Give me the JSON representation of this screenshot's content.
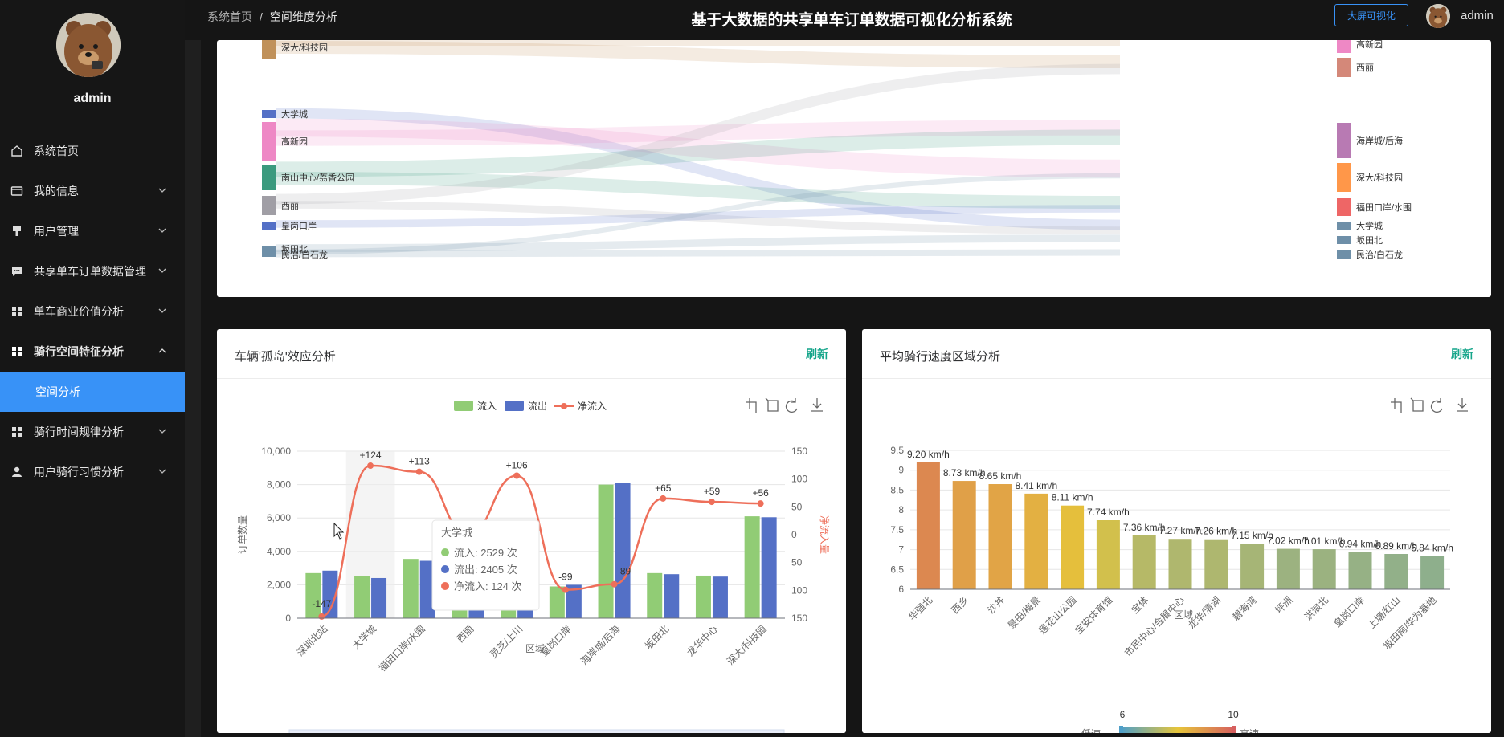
{
  "profile": {
    "name": "admin"
  },
  "menu": {
    "items": [
      {
        "label": "系统首页",
        "icon": "home-icon",
        "has_children": false
      },
      {
        "label": "我的信息",
        "icon": "id-card-icon",
        "has_children": true
      },
      {
        "label": "用户管理",
        "icon": "user-manage-icon",
        "has_children": true
      },
      {
        "label": "共享单车订单数据管理",
        "icon": "message-icon",
        "has_children": true
      },
      {
        "label": "单车商业价值分析",
        "icon": "grid-icon",
        "has_children": true
      },
      {
        "label": "骑行空间特征分析",
        "icon": "grid-icon",
        "has_children": true,
        "open": true
      },
      {
        "label": "骑行时间规律分析",
        "icon": "grid-icon",
        "has_children": true
      },
      {
        "label": "用户骑行习惯分析",
        "icon": "user-icon",
        "has_children": true
      }
    ],
    "active_sub": "空间分析"
  },
  "header": {
    "breadcrumb_home": "系统首页",
    "breadcrumb_sep": "/",
    "breadcrumb_current": "空间维度分析",
    "title": "基于大数据的共享单车订单数据可视化分析系统",
    "big_screen_label": "大屏可视化",
    "user": "admin"
  },
  "sankey": {
    "left_nodes": [
      {
        "label": "深大/科技园",
        "color": "#c0915a"
      },
      {
        "label": "大学城",
        "color": "#5470c6"
      },
      {
        "label": "高新园",
        "color": "#ee88c5"
      },
      {
        "label": "南山中心/荔香公园",
        "color": "#3b9a7e"
      },
      {
        "label": "西丽",
        "color": "#a09ea5"
      },
      {
        "label": "皇岗口岸",
        "color": "#5470c6"
      },
      {
        "label": "坂田北",
        "color": "#6e8fa8"
      },
      {
        "label": "民治/白石龙",
        "color": "#6e8fa8"
      }
    ],
    "right_nodes": [
      {
        "label": "高新园",
        "color": "#ee88c5"
      },
      {
        "label": "西丽",
        "color": "#d48879"
      },
      {
        "label": "海岸城/后海",
        "color": "#b87ab3"
      },
      {
        "label": "深大/科技园",
        "color": "#ff9749"
      },
      {
        "label": "福田口岸/水围",
        "color": "#ee6666"
      },
      {
        "label": "大学城",
        "color": "#6e8fa8"
      },
      {
        "label": "坂田北",
        "color": "#6e8fa8"
      },
      {
        "label": "民治/白石龙",
        "color": "#6e8fa8"
      }
    ]
  },
  "island_card": {
    "title": "车辆'孤岛'效应分析",
    "refresh": "刷新",
    "legend": [
      "流入",
      "流出",
      "净流入"
    ],
    "tooltip": {
      "title": "大学城",
      "lines": [
        "流入: 2529 次",
        "流出: 2405 次",
        "净流入: 124 次"
      ]
    }
  },
  "speed_card": {
    "title": "平均骑行速度区域分析",
    "refresh": "刷新",
    "visual_map": {
      "min": "6",
      "max": "10",
      "low_label": "低速",
      "high_label": "高速"
    }
  },
  "chart_data": [
    {
      "type": "bar",
      "categories": [
        "深圳北站",
        "大学城",
        "福田口岸/水围",
        "西丽",
        "灵芝/上川",
        "皇岗口岸",
        "海岸城/后海",
        "坂田北",
        "龙华中心",
        "深大/科技园"
      ],
      "series": [
        {
          "name": "流入",
          "values": [
            2700,
            2529,
            3550,
            2700,
            2700,
            1900,
            8000,
            2700,
            2550,
            6100
          ],
          "color": "#91cc75"
        },
        {
          "name": "流出",
          "values": [
            2847,
            2405,
            3437,
            2700,
            2594,
            1999,
            8089,
            2635,
            2491,
            6044
          ],
          "color": "#5470c6"
        },
        {
          "name": "净流入",
          "values": [
            -147,
            124,
            113,
            0,
            106,
            -99,
            -89,
            65,
            59,
            56
          ],
          "color": "#ee6f5a"
        }
      ],
      "data_labels": [
        "-147",
        "+124",
        "+113",
        "+106",
        "-99",
        "-89",
        "+65",
        "+59",
        "+56"
      ],
      "xlabel": "区域",
      "ylabel": "订单数量",
      "y2label": "净流入量",
      "ylim": [
        0,
        10000
      ],
      "y_ticks": [
        "0",
        "2,000",
        "4,000",
        "6,000",
        "8,000",
        "10,000"
      ],
      "y2lim": [
        -150,
        150
      ],
      "y2_ticks": [
        "150",
        "100",
        "50",
        "0",
        "50",
        "100",
        "150"
      ]
    },
    {
      "type": "bar",
      "categories": [
        "华强北",
        "西乡",
        "沙井",
        "景田/梅景",
        "莲花山公园",
        "宝安体育馆",
        "宝体",
        "市民中心/会展中心",
        "龙华/清湖",
        "碧海湾",
        "坪洲",
        "洪浪北",
        "皇岗口岸",
        "上塘/红山",
        "坂田南/华为基地"
      ],
      "values": [
        9.2,
        8.73,
        8.65,
        8.41,
        8.11,
        7.74,
        7.36,
        7.27,
        7.26,
        7.15,
        7.02,
        7.01,
        6.94,
        6.89,
        6.84
      ],
      "data_labels": [
        "9.20 km/h",
        "8.73 km/h",
        "8.65 km/h",
        "8.41 km/h",
        "8.11 km/h",
        "7.74 km/h",
        "7.36 km/h",
        "7.27 km/h",
        "7.26 km/h",
        "7.15 km/h",
        "7.02 km/h",
        "7.01 km/h",
        "6.94 km/h",
        "6.89 km/h",
        "6.84 km/h"
      ],
      "xlabel": "区域",
      "ylim": [
        6,
        9.5
      ],
      "y_ticks": [
        "6",
        "6.5",
        "7",
        "7.5",
        "8",
        "8.5",
        "9",
        "9.5"
      ]
    }
  ]
}
